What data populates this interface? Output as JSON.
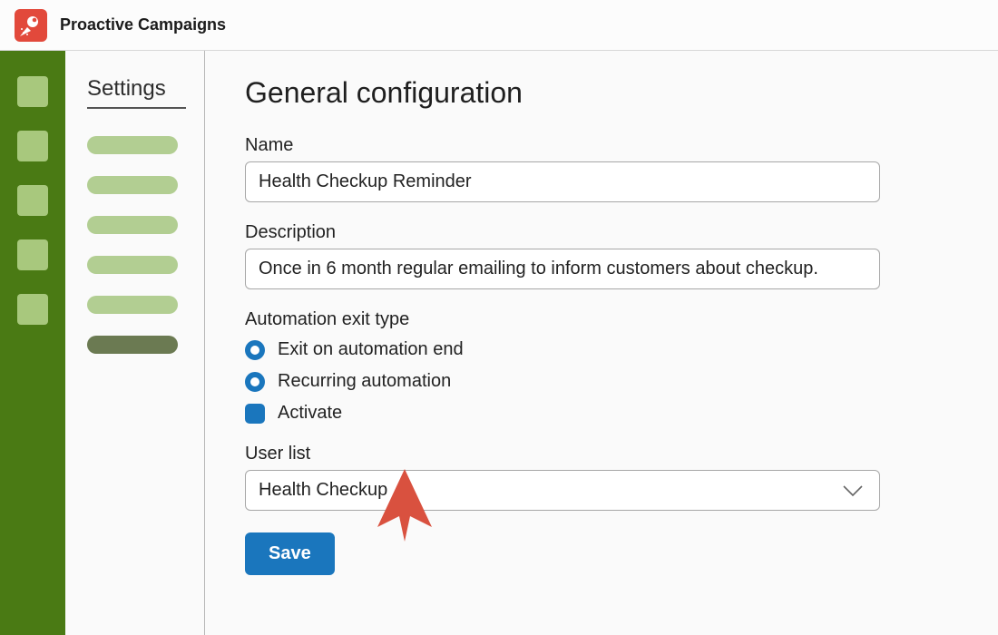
{
  "brand": {
    "title": "Proactive Campaigns"
  },
  "sidebar": {
    "title": "Settings"
  },
  "page": {
    "title": "General configuration",
    "name_label": "Name",
    "name_value": "Health Checkup Reminder",
    "description_label": "Description",
    "description_value": "Once in 6 month regular emailing to inform customers about checkup.",
    "exit_type_label": "Automation exit type",
    "exit_opt1": "Exit on automation end",
    "exit_opt2": "Recurring automation",
    "activate_label": "Activate",
    "userlist_label": "User list",
    "userlist_value": "Health Checkup",
    "save_label": "Save"
  }
}
